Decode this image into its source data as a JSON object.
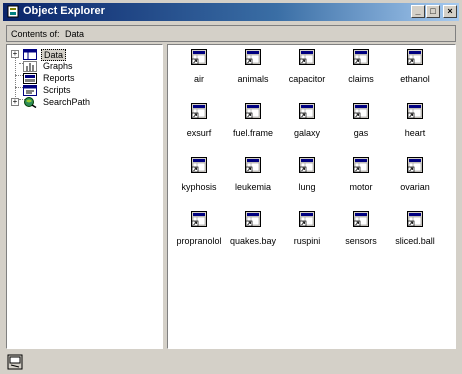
{
  "window": {
    "title": "Object Explorer"
  },
  "contents": {
    "label": "Contents of:",
    "value": "Data"
  },
  "tree": {
    "items": [
      {
        "label": "Data",
        "expander": "+",
        "icon": "data-folder-icon",
        "selected": true
      },
      {
        "label": "Graphs",
        "expander": "",
        "icon": "graphs-icon"
      },
      {
        "label": "Reports",
        "expander": "",
        "icon": "reports-icon"
      },
      {
        "label": "Scripts",
        "expander": "",
        "icon": "scripts-icon"
      },
      {
        "label": "SearchPath",
        "expander": "+",
        "icon": "searchpath-icon"
      }
    ]
  },
  "objects": [
    "air",
    "animals",
    "capacitor",
    "claims",
    "ethanol",
    "exsurf",
    "fuel.frame",
    "galaxy",
    "gas",
    "heart",
    "kyphosis",
    "leukemia",
    "lung",
    "motor",
    "ovarian",
    "propranolol",
    "quakes.bay",
    "ruspini",
    "sensors",
    "sliced.ball"
  ],
  "titlebar_buttons": {
    "minimize": "_",
    "maximize": "□",
    "close": "×"
  },
  "colors": {
    "titlebar_start": "#0a246a",
    "titlebar_end": "#a6caf0",
    "face": "#d4d0c8"
  }
}
